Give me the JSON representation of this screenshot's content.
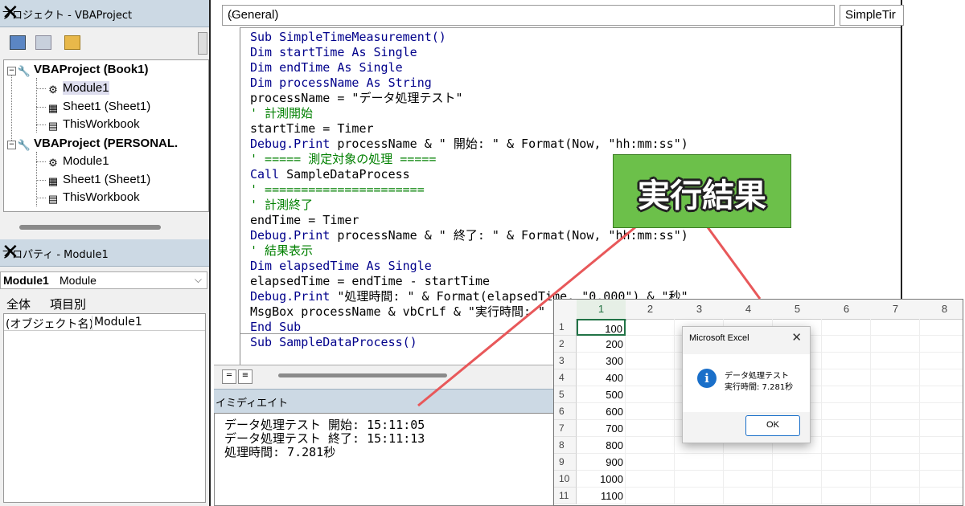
{
  "project_panel": {
    "title": "プロジェクト - VBAProject",
    "close": "✕",
    "tree": [
      {
        "label": "VBAProject (Book1)",
        "icon": "vbaproject-icon"
      },
      {
        "label": "Module1",
        "icon": "module-icon"
      },
      {
        "label": "Sheet1 (Sheet1)",
        "icon": "sheet-icon"
      },
      {
        "label": "ThisWorkbook",
        "icon": "workbook-icon"
      },
      {
        "label": "VBAProject (PERSONAL.",
        "icon": "vbaproject-icon"
      },
      {
        "label": "Module1",
        "icon": "module-icon"
      },
      {
        "label": "Sheet1 (Sheet1)",
        "icon": "sheet-icon"
      },
      {
        "label": "ThisWorkbook",
        "icon": "workbook-icon"
      }
    ]
  },
  "properties_panel": {
    "title": "プロパティ - Module1",
    "close": "✕",
    "object_name": "Module1",
    "object_type": "Module",
    "tab_all": "全体",
    "tab_category": "項目別",
    "row_key": "(オブジェクト名)",
    "row_value": "Module1"
  },
  "code_window": {
    "object_combo": "(General)",
    "proc_combo": "SimpleTir",
    "lines": [
      {
        "kind": "kw",
        "text": "Sub SimpleTimeMeasurement()"
      },
      {
        "kind": "kw",
        "text": "Dim startTime As Single"
      },
      {
        "kind": "kw",
        "text": "Dim endTime As Single"
      },
      {
        "kind": "kw",
        "text": "Dim processName As String"
      },
      {
        "kind": "tx",
        "text": "processName = \"データ処理テスト\""
      },
      {
        "kind": "cm",
        "text": "' 計測開始"
      },
      {
        "kind": "tx",
        "text": "startTime = Timer"
      },
      {
        "kind": "mix",
        "kw": "Debug.Print",
        "text": " processName & \" 開始: \" & Format(Now, \"hh:mm:ss\")"
      },
      {
        "kind": "cm",
        "text": "' ===== 測定対象の処理 ====="
      },
      {
        "kind": "mix",
        "kw": "Call",
        "text": " SampleDataProcess"
      },
      {
        "kind": "cm",
        "text": "' ======================"
      },
      {
        "kind": "cm",
        "text": "' 計測終了"
      },
      {
        "kind": "tx",
        "text": "endTime = Timer"
      },
      {
        "kind": "mix",
        "kw": "Debug.Print",
        "text": " processName & \" 終了: \" & Format(Now, \"hh:mm:ss\")"
      },
      {
        "kind": "cm",
        "text": "' 結果表示"
      },
      {
        "kind": "kw",
        "text": "Dim elapsedTime As Single"
      },
      {
        "kind": "tx",
        "text": "elapsedTime = endTime - startTime"
      },
      {
        "kind": "mix",
        "kw": "Debug.Print",
        "text": " \"処理時間: \" & Format(elapsedTime, \"0.000\") & \"秒\""
      },
      {
        "kind": "tx",
        "text": "MsgBox processName & vbCrLf & \"実行時間: \""
      },
      {
        "kind": "kw",
        "text": "End Sub"
      },
      {
        "kind": "kw",
        "text": "Sub SampleDataProcess()"
      }
    ]
  },
  "immediate": {
    "title": "イミディエイト",
    "lines": [
      "データ処理テスト 開始: 15:11:05",
      "データ処理テスト 終了: 15:11:13",
      "処理時間: 7.281秒"
    ]
  },
  "callout": {
    "text": "実行結果",
    "color": "#6cc04a",
    "line_color": "#e8585a"
  },
  "sheet": {
    "columns": [
      "1",
      "2",
      "3",
      "4",
      "5",
      "6",
      "7",
      "8"
    ],
    "rows": [
      "1",
      "2",
      "3",
      "4",
      "5",
      "6",
      "7",
      "8",
      "9",
      "10",
      "11"
    ],
    "values": [
      "100",
      "200",
      "300",
      "400",
      "500",
      "600",
      "700",
      "800",
      "900",
      "1000",
      "1100"
    ]
  },
  "msgbox": {
    "title": "Microsoft Excel",
    "close": "✕",
    "line1": "データ処理テスト",
    "line2": "実行時間: 7.281秒",
    "ok": "OK"
  }
}
